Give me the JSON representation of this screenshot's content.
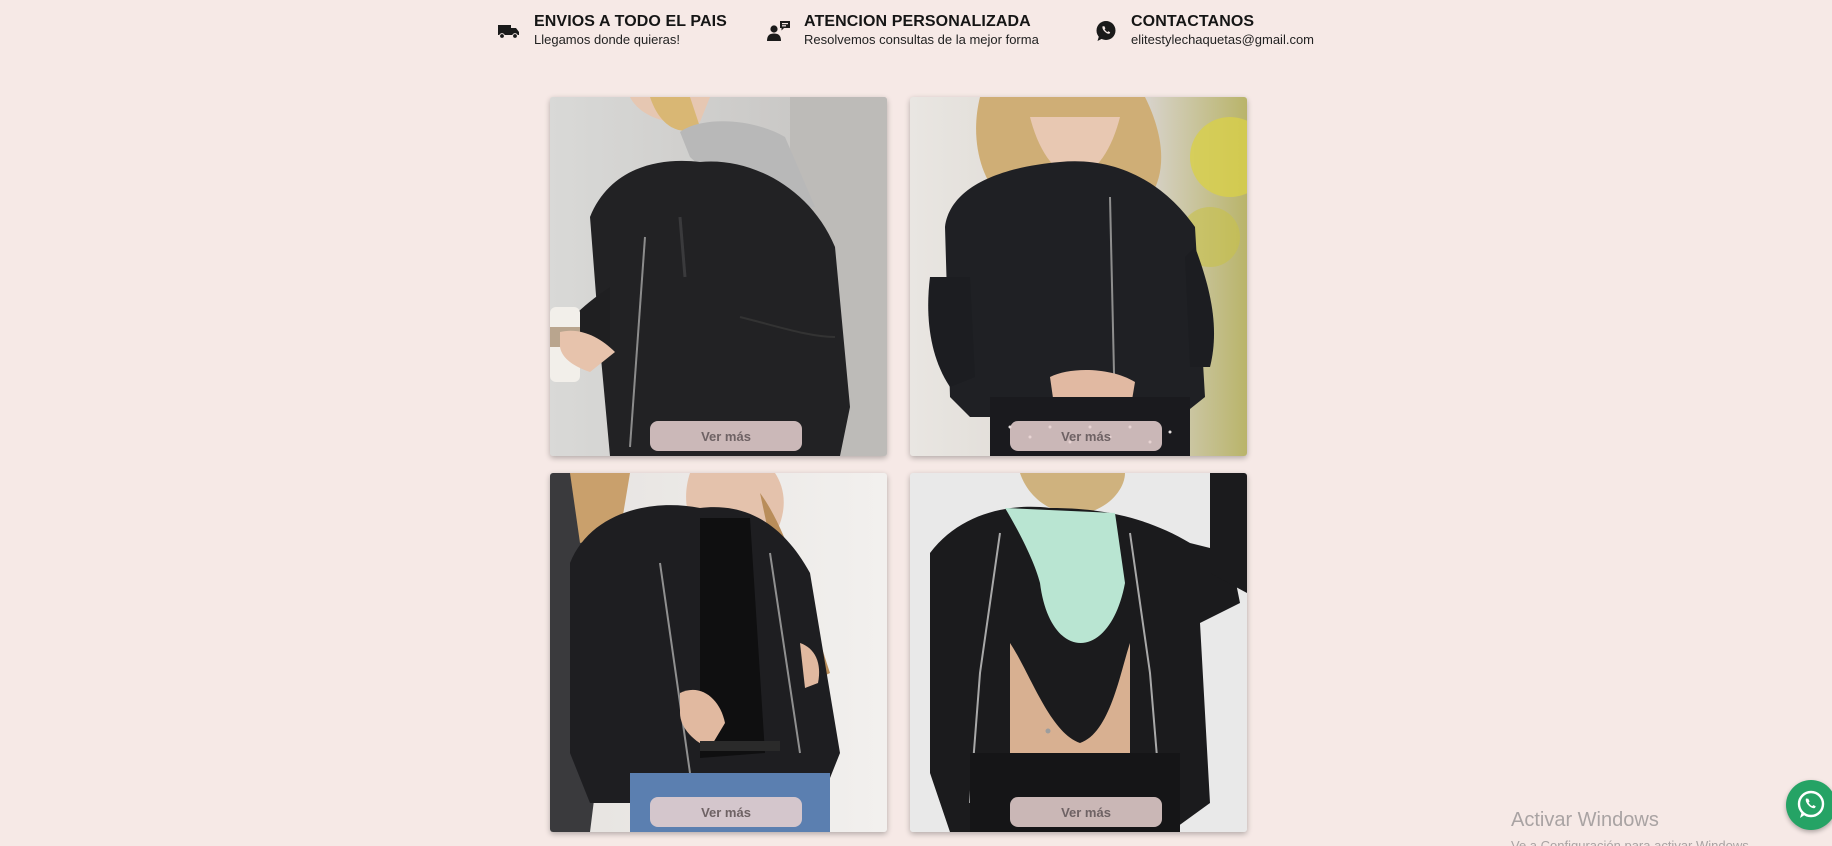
{
  "info_bar": {
    "shipping": {
      "icon": "truck-icon",
      "title": "ENVIOS A TODO EL PAIS",
      "subtitle": "Llegamos donde quieras!"
    },
    "attention": {
      "icon": "user-chat-icon",
      "title": "ATENCION PERSONALIZADA",
      "subtitle": "Resolvemos consultas de la mejor forma"
    },
    "contact": {
      "icon": "whatsapp-icon",
      "title": "CONTACTANOS",
      "subtitle": "elitestylechaquetas@gmail.com"
    }
  },
  "products": [
    {
      "button_label": "Ver más"
    },
    {
      "button_label": "Ver más"
    },
    {
      "button_label": "Ver más"
    },
    {
      "button_label": "Ver más"
    }
  ],
  "watermark": {
    "line1": "Activar Windows",
    "line2": "Ve a Configuración para activar Windows."
  },
  "colors": {
    "background": "#f6e9e6",
    "button_bg": "#e8d2d0",
    "whatsapp_green": "#25a365"
  }
}
